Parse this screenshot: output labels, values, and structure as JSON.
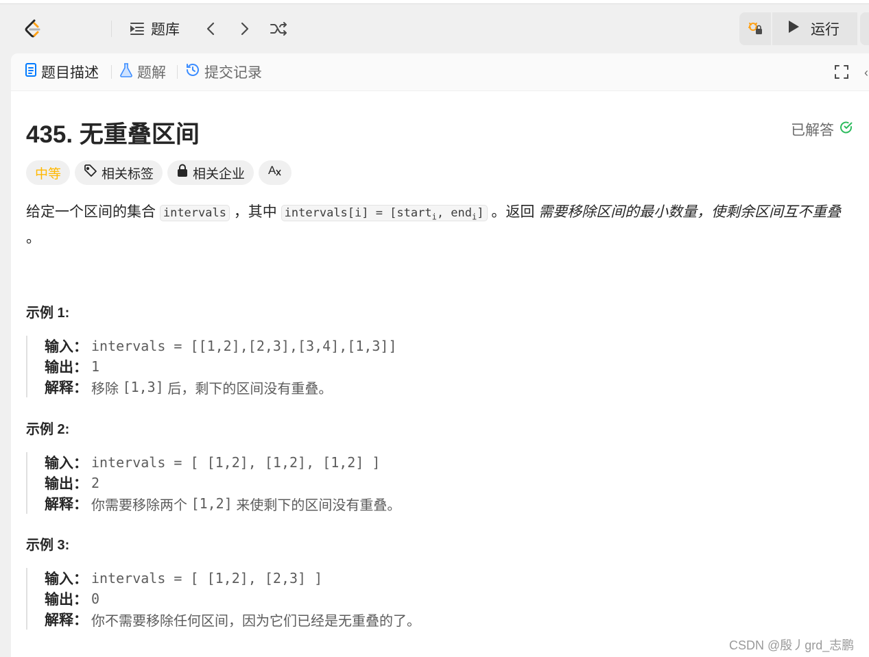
{
  "toolbar": {
    "problem_bank_label": "题库",
    "run_label": "运行"
  },
  "tabs": [
    {
      "label": "题目描述",
      "active": true
    },
    {
      "label": "题解",
      "active": false
    },
    {
      "label": "提交记录",
      "active": false
    }
  ],
  "problem": {
    "title": "435. 无重叠区间",
    "status": "已解答",
    "status_color": "#2cbb5d",
    "difficulty": "中等",
    "difficulty_color": "#ffb800",
    "chips": {
      "tags": "相关标签",
      "companies": "相关企业"
    },
    "description": {
      "p1": "给定一个区间的集合",
      "code1": "intervals",
      "p2": "，其中",
      "code2_a": "intervals[i] = [start",
      "code2_sub1": "i",
      "code2_b": ", end",
      "code2_sub2": "i",
      "code2_c": "]",
      "p3": "。返回",
      "emphasis": "需要移除区间的最小数量，使剩余区间互不重叠",
      "p4": "。"
    }
  },
  "examples": [
    {
      "title": "示例 1:",
      "input_label": "输入：",
      "input": "intervals = [[1,2],[2,3],[3,4],[1,3]]",
      "output_label": "输出：",
      "output": "1",
      "explain_label": "解释：",
      "explain_a": "移除 ",
      "explain_code": "[1,3]",
      "explain_b": " 后，剩下的区间没有重叠。"
    },
    {
      "title": "示例 2:",
      "input_label": "输入：",
      "input": "intervals = [ [1,2], [1,2], [1,2] ]",
      "output_label": "输出：",
      "output": "2",
      "explain_label": "解释：",
      "explain_a": "你需要移除两个 ",
      "explain_code": "[1,2]",
      "explain_b": " 来使剩下的区间没有重叠。"
    },
    {
      "title": "示例 3:",
      "input_label": "输入：",
      "input": "intervals = [ [1,2], [2,3] ]",
      "output_label": "输出：",
      "output": "0",
      "explain_label": "解释：",
      "explain_a": "你不需要移除任何区间，因为它们已经是无重叠的了。",
      "explain_code": "",
      "explain_b": ""
    }
  ],
  "watermark": "CSDN @殷丿grd_志鹏",
  "icons": [
    "leetcode-logo-icon",
    "list-icon",
    "chevron-left-icon",
    "chevron-right-icon",
    "shuffle-icon",
    "debug-icon",
    "play-icon",
    "document-icon",
    "flask-icon",
    "history-icon",
    "fullscreen-icon",
    "check-circle-icon",
    "tag-icon",
    "lock-icon",
    "translate-icon"
  ]
}
